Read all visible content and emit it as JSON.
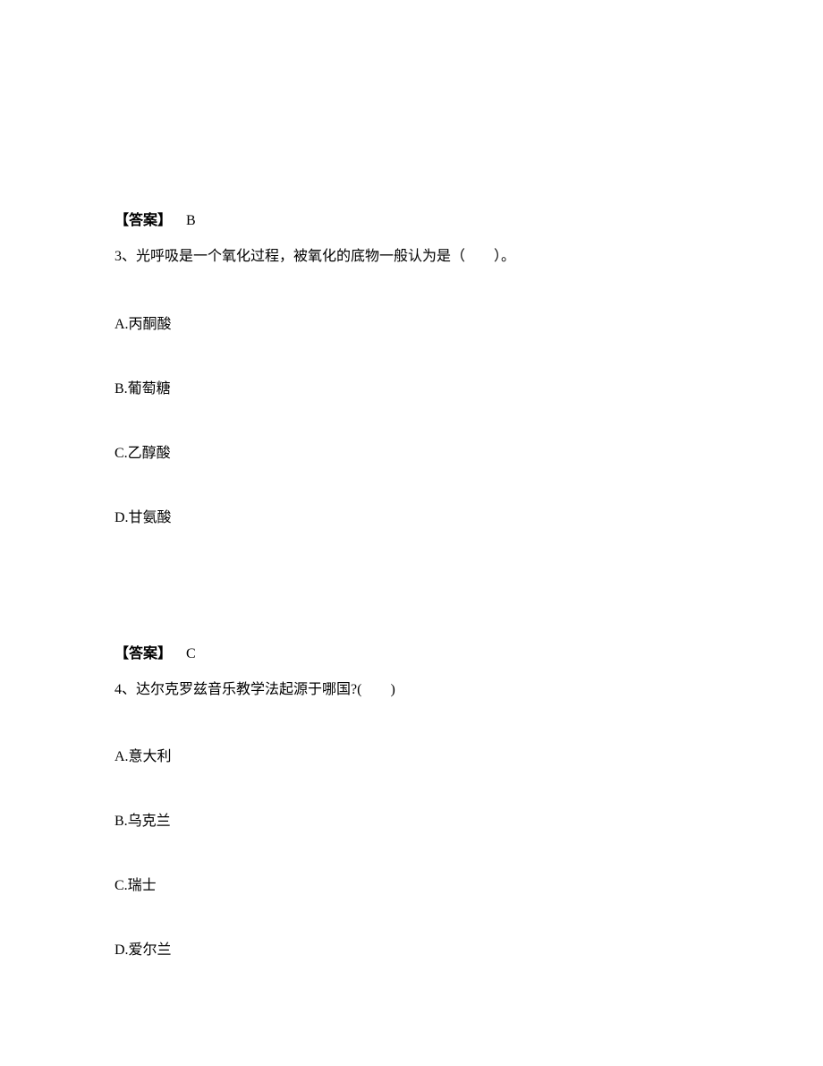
{
  "q2": {
    "answer_label": "【答案】",
    "answer_value": "B"
  },
  "q3": {
    "number": "3、",
    "text": "光呼吸是一个氧化过程，被氧化的底物一般认为是（　　）。",
    "options": {
      "a": "A.丙酮酸",
      "b": "B.葡萄糖",
      "c": "C.乙醇酸",
      "d": "D.甘氨酸"
    },
    "answer_label": "【答案】",
    "answer_value": "C"
  },
  "q4": {
    "number": "4、",
    "text": "达尔克罗兹音乐教学法起源于哪国?(　　)",
    "options": {
      "a": "A.意大利",
      "b": "B.乌克兰",
      "c": "C.瑞士",
      "d": "D.爱尔兰"
    }
  }
}
